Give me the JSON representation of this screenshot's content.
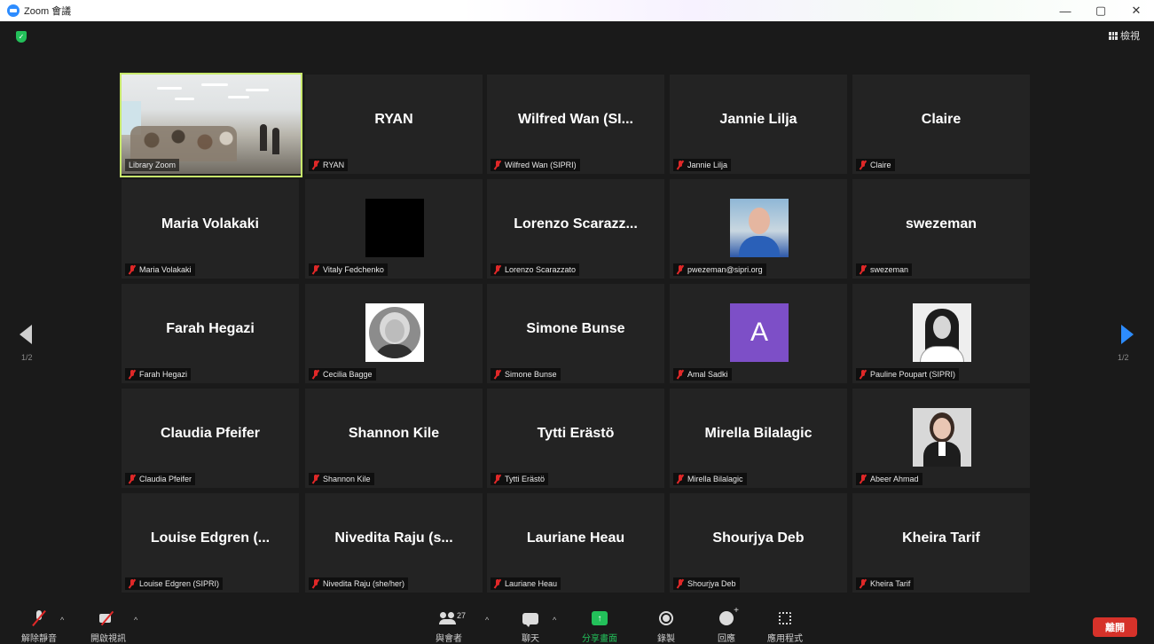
{
  "window": {
    "title": "Zoom 會議",
    "minimize": "—",
    "restore": "▢",
    "close": "✕"
  },
  "header": {
    "view_label": "檢視"
  },
  "pagination": {
    "left_page": "1/2",
    "right_page": "1/2"
  },
  "participants": [
    {
      "display": "",
      "label": "Library Zoom",
      "video": true
    },
    {
      "display": "RYAN",
      "label": "RYAN"
    },
    {
      "display": "Wilfred Wan (SI...",
      "label": "Wilfred Wan (SIPRI)"
    },
    {
      "display": "Jannie Lilja",
      "label": "Jannie Lilja"
    },
    {
      "display": "Claire",
      "label": "Claire"
    },
    {
      "display": "Maria Volakaki",
      "label": "Maria Volakaki"
    },
    {
      "display": "",
      "label": "Vitaly Fedchenko",
      "picture": "black"
    },
    {
      "display": "Lorenzo  Scarazz...",
      "label": "Lorenzo Scarazzato"
    },
    {
      "display": "",
      "label": "pwezeman@sipri.org",
      "picture": "photo-man"
    },
    {
      "display": "swezeman",
      "label": "swezeman"
    },
    {
      "display": "Farah Hegazi",
      "label": "Farah Hegazi"
    },
    {
      "display": "",
      "label": "Cecilia Bagge",
      "picture": "photo-woman-circle"
    },
    {
      "display": "Simone Bunse",
      "label": "Simone Bunse"
    },
    {
      "display": "",
      "label": "Amal Sadki",
      "picture": "letter",
      "letter": "A"
    },
    {
      "display": "",
      "label": "Pauline Poupart (SIPRI)",
      "picture": "photo-woman-dark-hair"
    },
    {
      "display": "Claudia Pfeifer",
      "label": "Claudia Pfeifer"
    },
    {
      "display": "Shannon Kile",
      "label": "Shannon Kile"
    },
    {
      "display": "Tytti Erästö",
      "label": "Tytti Erästö"
    },
    {
      "display": "Mirella Bilalagic",
      "label": "Mirella Bilalagic"
    },
    {
      "display": "",
      "label": "Abeer Ahmad",
      "picture": "photo-woman-suit"
    },
    {
      "display": "Louise  Edgren (...",
      "label": "Louise Edgren (SIPRI)"
    },
    {
      "display": "Nivedita Raju (s...",
      "label": "Nivedita Raju (she/her)"
    },
    {
      "display": "Lauriane Heau",
      "label": "Lauriane Heau"
    },
    {
      "display": "Shourjya Deb",
      "label": "Shourjya Deb"
    },
    {
      "display": "Kheira Tarif",
      "label": "Kheira Tarif"
    }
  ],
  "toolbar": {
    "unmute": "解除靜音",
    "start_video": "開啟視訊",
    "participants": "與會者",
    "participant_count": "27",
    "chat": "聊天",
    "share": "分享畫面",
    "record": "錄製",
    "reactions": "回應",
    "apps": "應用程式",
    "leave": "離開",
    "caret": "^"
  },
  "colors": {
    "background": "#1a1a1a",
    "tile": "#232323",
    "active_speaker": "#c8e86c",
    "share_green": "#23c05a",
    "leave_red": "#d6322a",
    "accent_blue": "#2d8cff",
    "muted_red": "#e02828"
  }
}
